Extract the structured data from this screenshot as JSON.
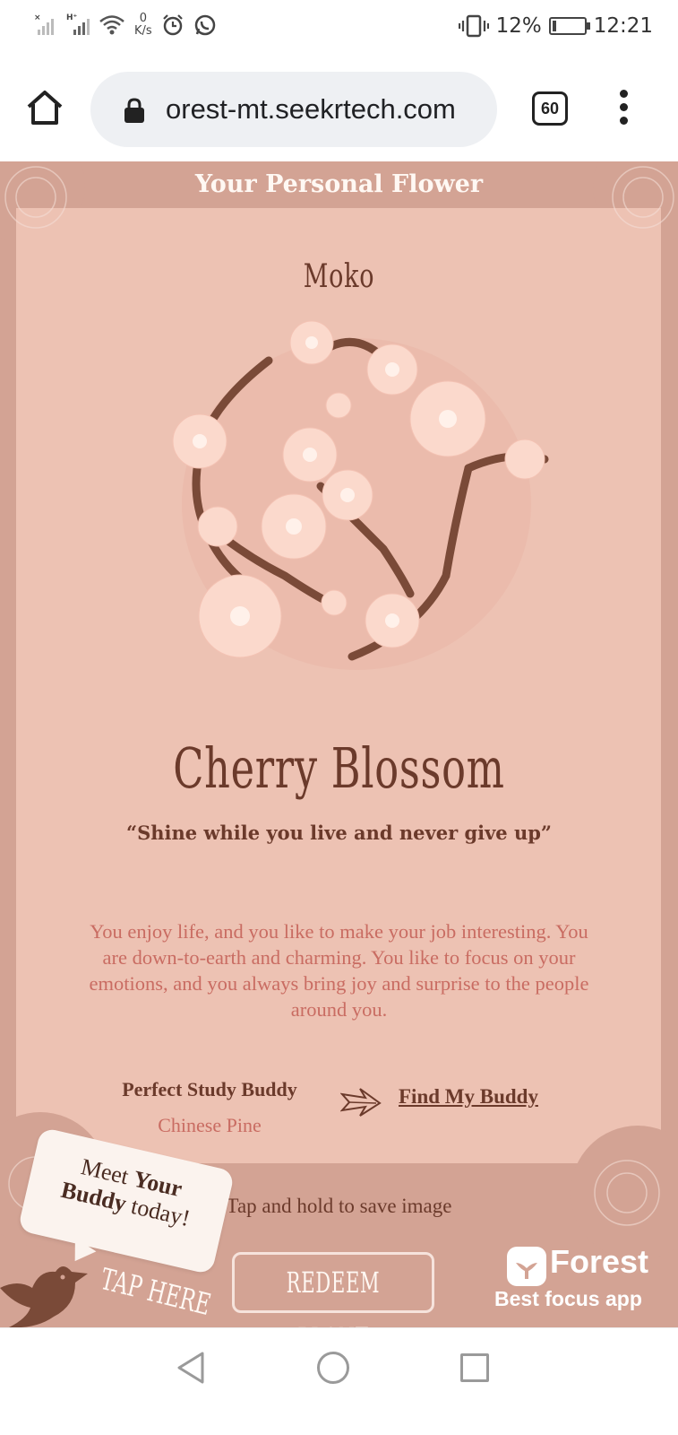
{
  "status_bar": {
    "net_speed_value": "0",
    "net_speed_unit": "K/s",
    "battery_percent": "12%",
    "battery_level": 0.12,
    "time": "12:21",
    "icons": [
      "signal-icon",
      "signal-hplus-icon",
      "wifi-icon",
      "alarm-icon",
      "whatsapp-icon",
      "vibrate-icon",
      "battery-charging-icon"
    ]
  },
  "browser": {
    "url": "orest-mt.seekrtech.com",
    "tab_count": "60",
    "icons": [
      "home-icon",
      "lock-icon",
      "menu-dots-icon"
    ]
  },
  "page": {
    "title": "Your Personal Flower",
    "user_name": "Moko",
    "flower_name": "Cherry Blossom",
    "quote": "“Shine while you live and never give up”",
    "description": "You enjoy life, and you like to make your job interesting. You are down-to-earth and charming. You like to focus on your emotions, and you always bring joy and surprise to the people around you.",
    "buddy_label": "Perfect Study Buddy",
    "buddy_value": "Chinese Pine",
    "find_buddy_link": "Find My Buddy",
    "save_hint": "Tap and hold to save image"
  },
  "footer": {
    "bubble_line1_a": "Meet ",
    "bubble_line1_b": "Your",
    "bubble_line2_a": "Buddy",
    "bubble_line2_b": " today!",
    "tap_here": "TAP HERE",
    "redeem_button": "REDEEM PLANT",
    "brand_name": "Forest",
    "brand_tagline": "Best focus app"
  },
  "colors": {
    "page_bg": "#d3a394",
    "card_bg": "#edc2b3",
    "dark_brown": "#6b3a2b",
    "text_coral": "#c96c62",
    "petal": "#fbd9cc"
  }
}
